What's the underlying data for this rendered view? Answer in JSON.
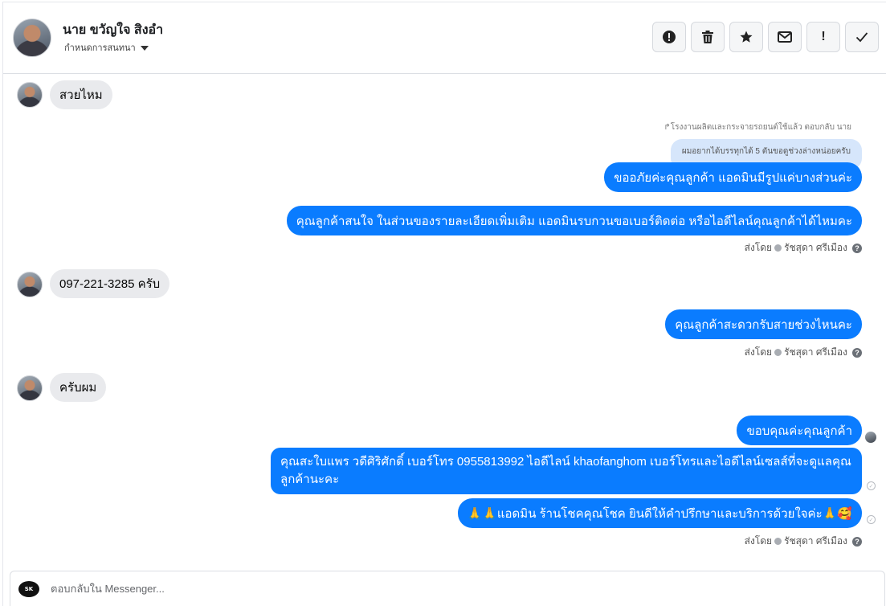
{
  "header": {
    "contact_name": "นาย ขวัญใจ สิงอำ",
    "assign_label": "กำหนดการสนทนา",
    "actions": [
      {
        "icon": "alert-circle-icon",
        "glyph": "!"
      },
      {
        "icon": "trash-icon",
        "glyph": "🗑"
      },
      {
        "icon": "star-icon",
        "glyph": "★"
      },
      {
        "icon": "envelope-icon",
        "glyph": "✉"
      },
      {
        "icon": "exclamation-icon",
        "glyph": "!"
      },
      {
        "icon": "checkmark-icon",
        "glyph": "✓"
      }
    ]
  },
  "messages": {
    "m1": "สวยไหม",
    "reply_note": "โรงงานผลิตและกระจายรถยนต์ใช้แล้ว ตอบกลับ นาย",
    "quoted": "ผมอยากได้บรรทุกได้ 5 ตันขอดูช่วงล่างหน่อยครับ",
    "m2": "ขออภัยค่ะคุณลูกค้า  แอดมินมีรูปแค่บางส่วนค่ะ",
    "m3": "คุณลูกค้าสนใจ ในส่วนของรายละเอียดเพิ่มเติม แอดมินรบกวนขอเบอร์ติดต่อ หรือไอดีไลน์คุณลูกค้าได้ไหมคะ",
    "m4": "097-221-3285 ครับ",
    "m5": "คุณลูกค้าสะดวกรับสายช่วงไหนคะ",
    "m6": "ครับผม",
    "m7": "ขอบคุณค่ะคุณลูกค้า",
    "m8": "คุณสะใบแพร วดีศิริศักดิ์ เบอร์โทร 0955813992  ไอดีไลน์  khaofanghom  เบอร์โทรและไอดีไลน์เซลส์ที่จะดูแลคุณลูกค้านะคะ",
    "m9": "🙏🙏แอดมิน ร้านโชคคุณโชค ยินดีให้คำปรึกษาและบริการด้วยใจค่ะ🙏🥰"
  },
  "sent_by": {
    "prefix": "ส่งโดย",
    "name": "รัชสุดา ศรีเมือง"
  },
  "composer": {
    "placeholder": "ตอบกลับใน Messenger...",
    "logo_text": "SK"
  }
}
